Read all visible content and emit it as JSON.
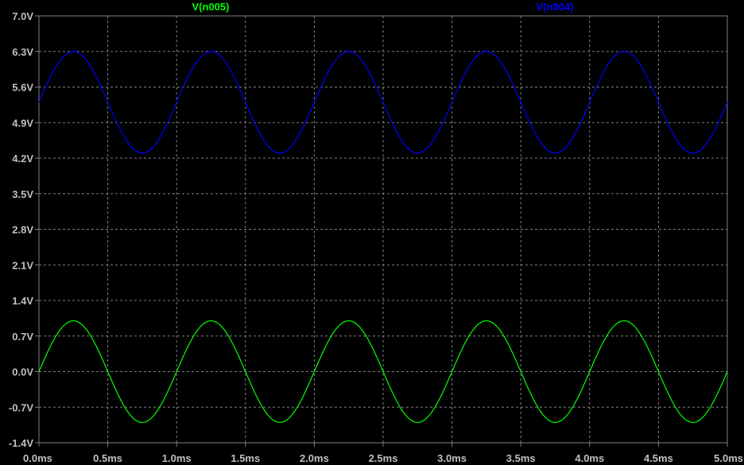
{
  "chart_data": {
    "type": "line",
    "x_ticks": [
      "0.0ms",
      "0.5ms",
      "1.0ms",
      "1.5ms",
      "2.0ms",
      "2.5ms",
      "3.0ms",
      "3.5ms",
      "4.0ms",
      "4.5ms",
      "5.0ms"
    ],
    "y_ticks": [
      "7.0V",
      "6.3V",
      "5.6V",
      "4.9V",
      "4.2V",
      "3.5V",
      "2.8V",
      "2.1V",
      "1.4V",
      "0.7V",
      "0.0V",
      "-0.7V",
      "-1.4V"
    ],
    "xlim": [
      0,
      5.0
    ],
    "ylim": [
      -1.4,
      7.0
    ],
    "x_unit": "ms",
    "y_unit": "V",
    "grid": true,
    "legend_placement": "top",
    "background": "#000000",
    "frame_color": "#808080",
    "grid_color": "#808080",
    "series": [
      {
        "name": "V(n005)",
        "color": "#00ff00",
        "offset": 0.0,
        "amplitude": 1.0,
        "frequency_per_ms": 1.0,
        "phase_deg": 0,
        "samples": 500
      },
      {
        "name": "V(n004)",
        "color": "#0000ff",
        "offset": 5.3,
        "amplitude": 1.0,
        "frequency_per_ms": 1.0,
        "phase_deg": 0,
        "samples": 500
      }
    ]
  }
}
